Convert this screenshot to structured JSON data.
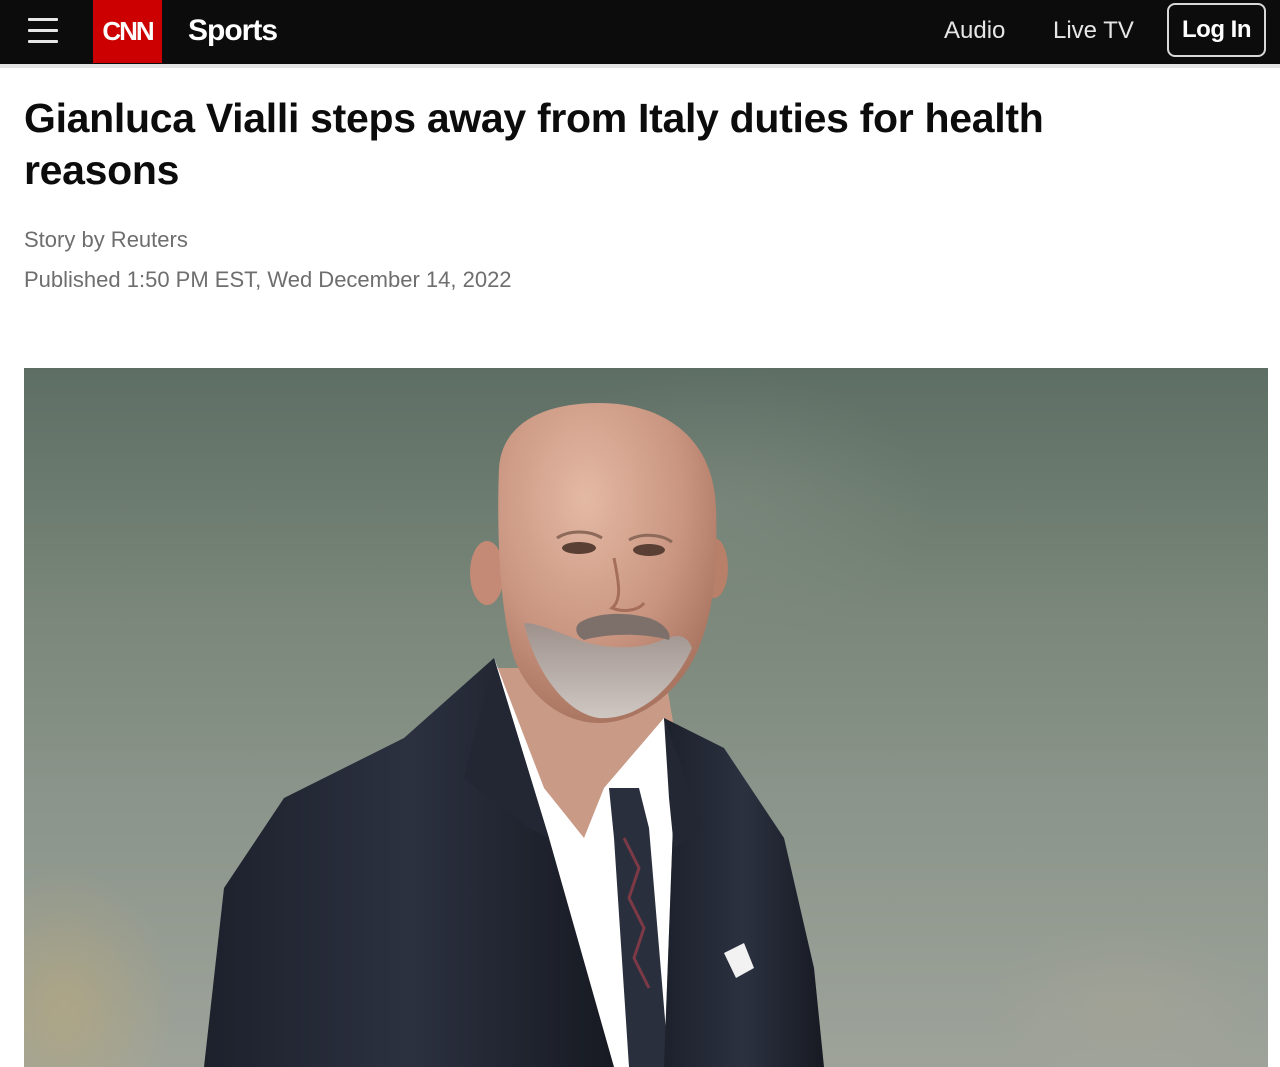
{
  "header": {
    "logo_text": "CNN",
    "section": "Sports",
    "nav": {
      "audio": "Audio",
      "live_tv": "Live TV",
      "login": "Log In"
    },
    "colors": {
      "bar": "#0c0c0c",
      "logo_red": "#cc0000"
    }
  },
  "article": {
    "headline": "Gianluca Vialli steps away from Italy duties for health reasons",
    "byline": "Story by Reuters",
    "published": "Published 1:50 PM EST, Wed December 14, 2022"
  },
  "icons": {
    "menu": "hamburger-menu-icon"
  }
}
